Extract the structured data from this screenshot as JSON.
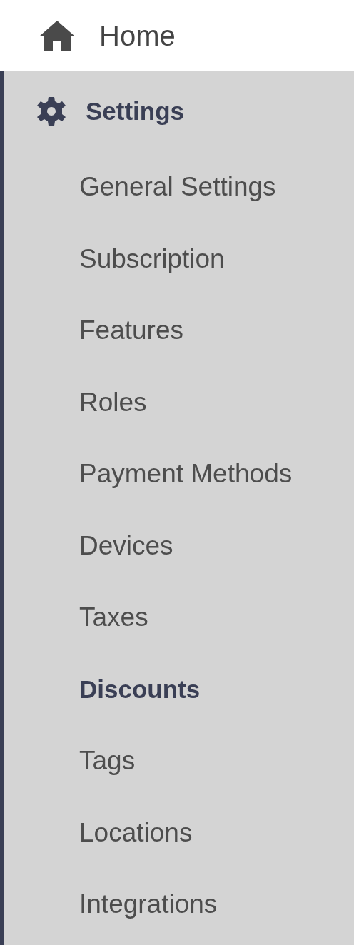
{
  "home": {
    "label": "Home"
  },
  "settings": {
    "label": "Settings",
    "expanded": true,
    "items": [
      {
        "label": "General Settings",
        "selected": false
      },
      {
        "label": "Subscription",
        "selected": false
      },
      {
        "label": "Features",
        "selected": false
      },
      {
        "label": "Roles",
        "selected": false
      },
      {
        "label": "Payment Methods",
        "selected": false
      },
      {
        "label": "Devices",
        "selected": false
      },
      {
        "label": "Taxes",
        "selected": false
      },
      {
        "label": "Discounts",
        "selected": true
      },
      {
        "label": "Tags",
        "selected": false
      },
      {
        "label": "Locations",
        "selected": false
      },
      {
        "label": "Integrations",
        "selected": false
      }
    ]
  }
}
